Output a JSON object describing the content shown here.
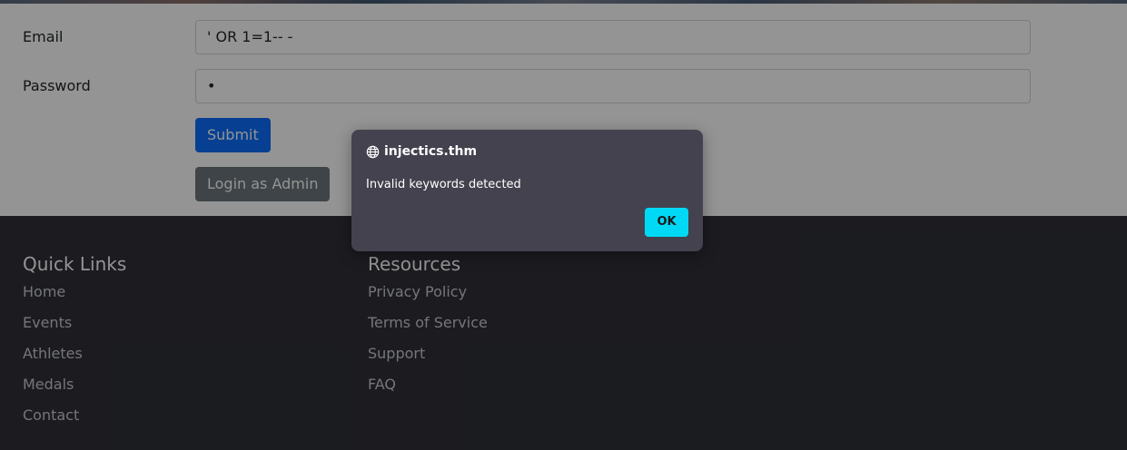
{
  "form": {
    "email_label": "Email",
    "email_value": "' OR 1=1-- -",
    "password_label": "Password",
    "password_value": "•",
    "submit_label": "Submit",
    "admin_login_label": "Login as Admin"
  },
  "footer": {
    "quick_links_title": "Quick Links",
    "quick_links": [
      "Home",
      "Events",
      "Athletes",
      "Medals",
      "Contact"
    ],
    "resources_title": "Resources",
    "resources": [
      "Privacy Policy",
      "Terms of Service",
      "Support",
      "FAQ"
    ]
  },
  "dialog": {
    "origin": "injectics.thm",
    "message": "Invalid keywords detected",
    "ok_label": "OK"
  },
  "colors": {
    "primary": "#0d6efd",
    "secondary": "#6c757d",
    "footer_bg": "#2f3037",
    "dialog_bg": "#44424f",
    "dialog_button": "#00d9f5"
  }
}
